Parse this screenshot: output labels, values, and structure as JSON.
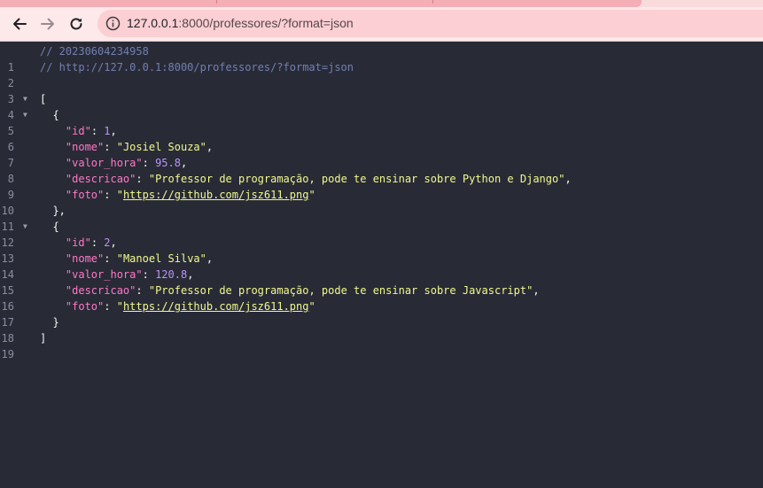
{
  "browser": {
    "url_host": "127.0.0.1",
    "url_rest": ":8000/professores/?format=json"
  },
  "viewer": {
    "comment_timestamp": "// 20230604234958",
    "comment_url": "// http://127.0.0.1:8000/professores/?format=json",
    "line_numbers": [
      "1",
      "2",
      "3",
      "4",
      "5",
      "6",
      "7",
      "8",
      "9",
      "10",
      "11",
      "12",
      "13",
      "14",
      "15",
      "16",
      "17",
      "18",
      "19"
    ],
    "records": [
      {
        "id_key": "\"id\"",
        "id": "1",
        "nome_key": "\"nome\"",
        "nome": "\"Josiel Souza\"",
        "valor_hora_key": "\"valor_hora\"",
        "valor_hora": "95.8",
        "descricao_key": "\"descricao\"",
        "descricao": "\"Professor de programação, pode te ensinar sobre Python e Django\"",
        "foto_key": "\"foto\"",
        "foto": "https://github.com/jsz611.png"
      },
      {
        "id_key": "\"id\"",
        "id": "2",
        "nome_key": "\"nome\"",
        "nome": "\"Manoel Silva\"",
        "valor_hora_key": "\"valor_hora\"",
        "valor_hora": "120.8",
        "descricao_key": "\"descricao\"",
        "descricao": "\"Professor de programação, pode te ensinar sobre Javascript\"",
        "foto_key": "\"foto\"",
        "foto": "https://github.com/jsz611.png"
      }
    ]
  }
}
